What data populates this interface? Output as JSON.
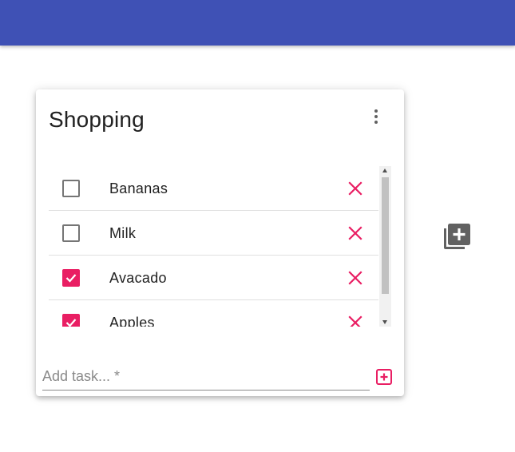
{
  "colors": {
    "app_bar": "#3f51b5",
    "accent": "#e91e63",
    "icon_gray": "#616161"
  },
  "card": {
    "title": "Shopping",
    "menu_icon": "more-vert-icon",
    "items": [
      {
        "label": "Bananas",
        "checked": false
      },
      {
        "label": "Milk",
        "checked": false
      },
      {
        "label": "Avacado",
        "checked": true
      },
      {
        "label": "Apples",
        "checked": true
      }
    ],
    "delete_icon": "close-icon",
    "input": {
      "placeholder": "Add task... *",
      "value": ""
    },
    "add_task_icon": "add-box-icon"
  },
  "add_list_icon": "library-add-icon"
}
